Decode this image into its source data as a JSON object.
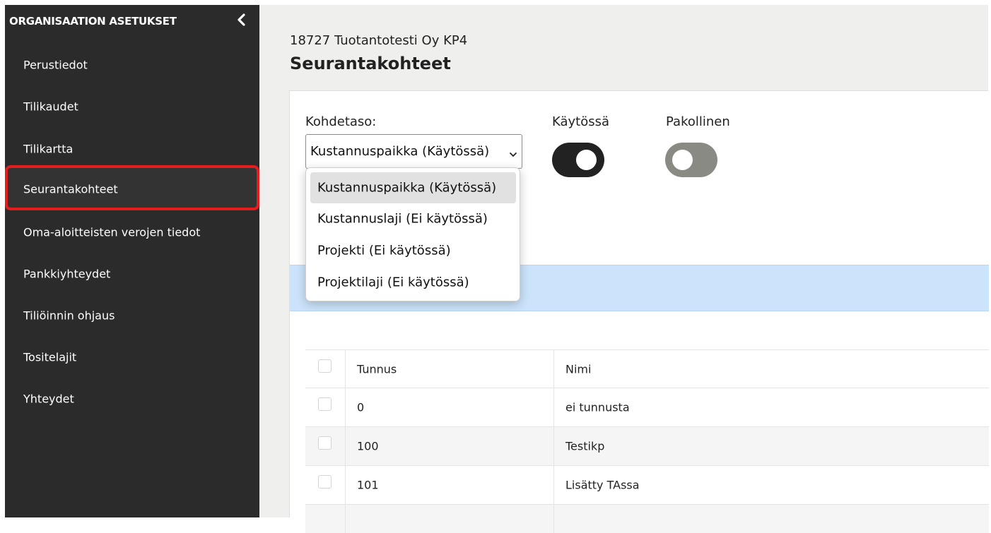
{
  "sidebar": {
    "title": "ORGANISAATION ASETUKSET",
    "collapse_icon": "chevron-left-icon",
    "items": [
      {
        "label": "Perustiedot"
      },
      {
        "label": "Tilikaudet"
      },
      {
        "label": "Tilikartta"
      },
      {
        "label": "Seurantakohteet",
        "active": true
      },
      {
        "label": "Oma-aloitteisten verojen tiedot"
      },
      {
        "label": "Pankkiyhteydet"
      },
      {
        "label": "Tiliöinnin ohjaus"
      },
      {
        "label": "Tositelajit"
      },
      {
        "label": "Yhteydet"
      }
    ]
  },
  "header": {
    "org_name": "18727 Tuotantotesti Oy KP4",
    "page_title": "Seurantakohteet"
  },
  "filters": {
    "level_label": "Kohdetaso:",
    "level_value": "Kustannuspaikka (Käytössä)",
    "level_options": [
      "Kustannuspaikka (Käytössä)",
      "Kustannuslaji (Ei käytössä)",
      "Projekti (Ei käytössä)",
      "Projektilaji (Ei käytössä)"
    ],
    "in_use_label": "Käytössä",
    "in_use_on": true,
    "mandatory_label": "Pakollinen",
    "mandatory_on": false
  },
  "table": {
    "columns": [
      "Tunnus",
      "Nimi"
    ],
    "rows": [
      {
        "code": "0",
        "name": "ei tunnusta"
      },
      {
        "code": "100",
        "name": "Testikp"
      },
      {
        "code": "101",
        "name": "Lisätty TAssa"
      }
    ]
  },
  "colors": {
    "sidebar_bg": "#2b2b2b",
    "highlight": "#e11d1d",
    "toggle_on": "#222222",
    "toggle_off": "#8a8a85",
    "info_banner": "#cbe4fb"
  }
}
